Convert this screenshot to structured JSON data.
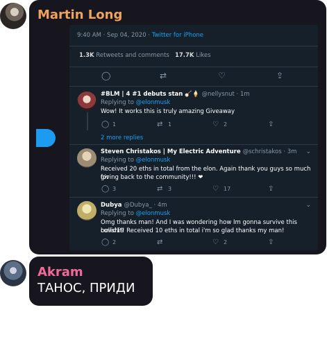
{
  "message1": {
    "sender": "Martin Long",
    "tweet": {
      "meta_time": "9:40 AM · Sep 04, 2020 · ",
      "meta_source": "Twitter for iPhone",
      "stats_retweets": "1.3K",
      "stats_retweets_label": "Retweets and comments",
      "stats_likes": "17.7K",
      "stats_likes_label": "Likes",
      "replies": [
        {
          "name": "#BLM | 4 #1 debuts stan 🪕🍦",
          "handle": "@nellysnut · 1m",
          "replying_prefix": "Replying to ",
          "replying_to": "@elonmusk",
          "text": "Wow! It works this is truly amazing Giveaway",
          "reply_count": "1",
          "retweet_count": "1",
          "like_count": "2",
          "more_replies": "2 more replies"
        },
        {
          "name": "Steven Christakos | My Electric Adventure",
          "handle": "@schristakos · 3m",
          "replying_prefix": "Replying to ",
          "replying_to": "@elonmusk",
          "text_line1": "Received 20 eths in total from the elon. Again thank you guys so much for",
          "text_line2": "giving back to the community!!! ❤",
          "reply_count": "3",
          "retweet_count": "3",
          "like_count": "17"
        },
        {
          "name": "Dubya",
          "handle": "@Dubya_ · 4m",
          "replying_prefix": "Replying to ",
          "replying_to": "@elonmusk",
          "text_line1": "Omg thanks man! And I was wondering how Im gonna survive this covid19",
          "text_line2": "bullshit! Received 10 eths in total i'm so glad thanks my man!",
          "reply_count": "2",
          "like_count": "2"
        }
      ]
    }
  },
  "message2": {
    "sender": "Akram",
    "text": "ТАНОС, ПРИДИ"
  },
  "colors": {
    "bubble": "#17151d",
    "tweet_bg": "#15202b",
    "link": "#1da1f2",
    "sender1": "#f0a35a",
    "sender2": "#ef6a99"
  }
}
